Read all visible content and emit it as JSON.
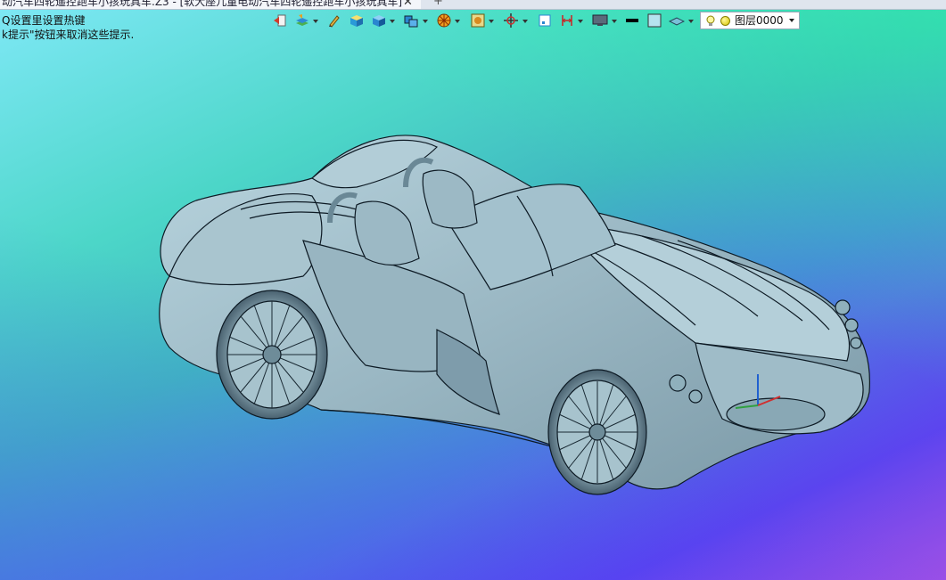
{
  "tab": {
    "title": "动汽车四轮遥控跑车小孩玩具车.Z3 - [软大座儿童电动汽车四轮遥控跑车小孩玩具车]",
    "close": "✕",
    "add": "+"
  },
  "hints": {
    "line1": "Q设置里设置热键",
    "line2": "k提示\"按钮来取消这些提示."
  },
  "toolbar": {
    "icons": [
      "exit-icon",
      "layers-icon",
      "pencil-icon",
      "box-shaded-icon",
      "box-blue-icon",
      "view-cube-icon",
      "render-sphere-icon",
      "frame-icon",
      "navigate-icon",
      "page-icon",
      "dimension-icon",
      "monitor-icon",
      "line-color-icon",
      "fill-color-icon",
      "plane-icon"
    ]
  },
  "layer": {
    "current": "图层0000"
  },
  "colors": {
    "model_fill": "#9fbdca",
    "model_stroke": "#0d1a24"
  }
}
